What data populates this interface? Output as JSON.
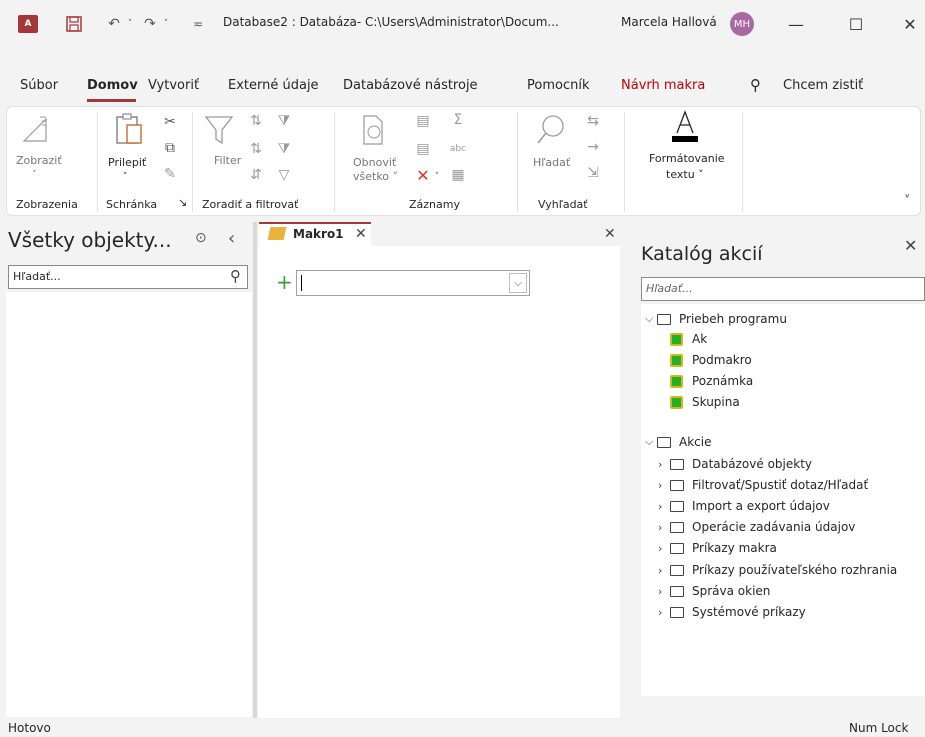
{
  "titlebar": {
    "app_badge": "A",
    "title": "Database2 : Databáza- C:\\Users\\Administrator\\Docum...",
    "user_name": "Marcela Hallová",
    "user_initials": "MH",
    "minimize": "—",
    "maximize": "☐",
    "close": "✕"
  },
  "menu": {
    "tabs": [
      "Súbor",
      "Domov",
      "Vytvoriť",
      "Externé údaje",
      "Databázové nástroje",
      "Pomocník",
      "Návrh makra"
    ],
    "search_label": "Chcem zistiť",
    "accent": "#a4373a",
    "highlight_tab_color": "#c00000"
  },
  "ribbon": {
    "view_label": "Zobraziť",
    "paste_label": "Prilepiť",
    "filter_label": "Filter",
    "refresh_label": "Obnoviť všetko",
    "refresh_line1": "Obnoviť",
    "refresh_line2": "všetko ˅",
    "find_label": "Hľadať",
    "format_line1": "Formátovanie",
    "format_line2": "textu ˅",
    "groups": [
      "Zobrazenia",
      "Schránka",
      "Zoradiť a filtrovať",
      "Záznamy",
      "Vyhľadať"
    ],
    "sum_icon": "Σ",
    "abc_icon": "abc"
  },
  "nav_pane": {
    "title": "Všetky objekty...",
    "search_placeholder": "Hľadať..."
  },
  "document": {
    "tab_label": "Makro1"
  },
  "catalog": {
    "title": "Katalóg akcií",
    "search_placeholder": "Hľadať...",
    "program_flow": {
      "label": "Priebeh programu",
      "items": [
        "Ak",
        "Podmakro",
        "Poznámka",
        "Skupina"
      ]
    },
    "actions": {
      "label": "Akcie",
      "items": [
        "Databázové objekty",
        "Filtrovať/Spustiť dotaz/Hľadať",
        "Import a export údajov",
        "Operácie zadávania údajov",
        "Príkazy makra",
        "Príkazy používateľského rozhrania",
        "Správa okien",
        "Systémové príkazy"
      ]
    }
  },
  "status": {
    "left": "Hotovo",
    "right": "Num Lock"
  }
}
